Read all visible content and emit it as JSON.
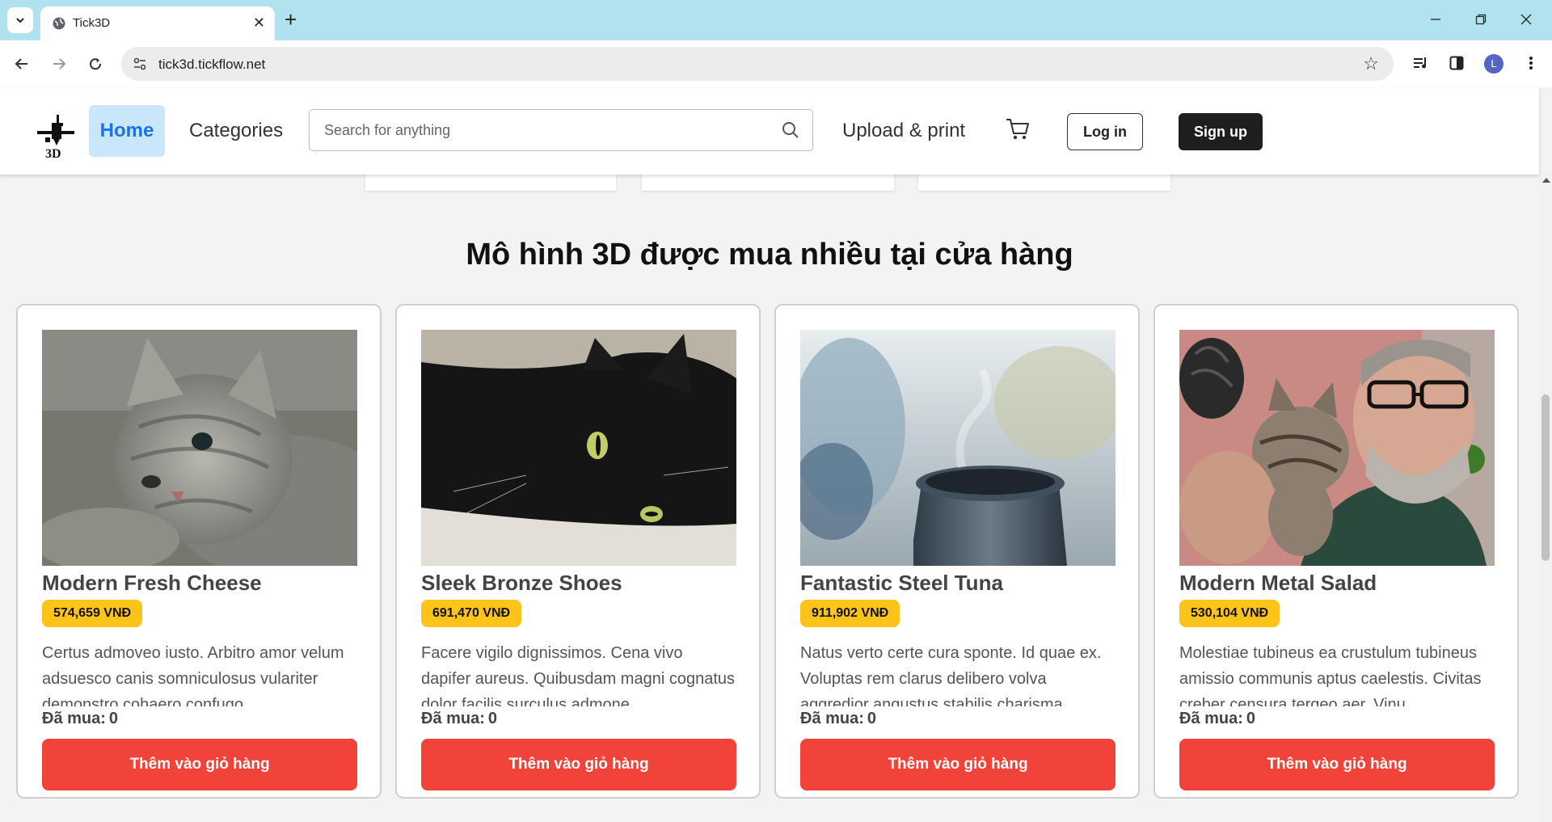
{
  "browser": {
    "tab_title": "Tick3D",
    "url": "tick3d.tickflow.net",
    "profile_initial": "L"
  },
  "header": {
    "home": "Home",
    "categories": "Categories",
    "search_placeholder": "Search for anything",
    "upload": "Upload & print",
    "login": "Log in",
    "signup": "Sign up"
  },
  "section": {
    "title": "Mô hình 3D được mua nhiều tại cửa hàng"
  },
  "products": [
    {
      "name": "Modern Fresh Cheese",
      "price": "574,659 VNĐ",
      "description": "Certus admoveo iusto. Arbitro amor velum adsuesco canis somniculosus vulariter demonstro cohaero confugo....",
      "sold_label": "Đã mua:",
      "sold_count": "0",
      "button": "Thêm vào giỏ hàng",
      "image": "grey-kitten-photo"
    },
    {
      "name": "Sleek Bronze Shoes",
      "price": "691,470 VNĐ",
      "description": "Facere vigilo dignissimos. Cena vivo dapifer aureus. Quibusdam magni cognatus dolor facilis surculus admone...",
      "sold_label": "Đã mua:",
      "sold_count": "0",
      "button": "Thêm vào giỏ hàng",
      "image": "black-cat-photo"
    },
    {
      "name": "Fantastic Steel Tuna",
      "price": "911,902 VNĐ",
      "description": "Natus verto certe cura sponte. Id quae ex. Voluptas rem clarus delibero volva aggredior angustus stabilis charisma...",
      "sold_label": "Đã mua:",
      "sold_count": "0",
      "button": "Thêm vào giỏ hàng",
      "image": "steaming-mug-photo"
    },
    {
      "name": "Modern Metal Salad",
      "price": "530,104 VNĐ",
      "description": "Molestiae tubineus ea crustulum tubineus amissio communis aptus caelestis. Civitas creber censura tergeo aer. Vinu...",
      "sold_label": "Đã mua:",
      "sold_count": "0",
      "button": "Thêm vào giỏ hàng",
      "image": "man-with-kitten-photo"
    }
  ],
  "colors": {
    "tab_strip": "#b0e2f0",
    "home_bg": "#c9e6fb",
    "price_badge": "#fcc419",
    "cart_button": "#f1433a",
    "signup_bg": "#1e1e1e"
  }
}
